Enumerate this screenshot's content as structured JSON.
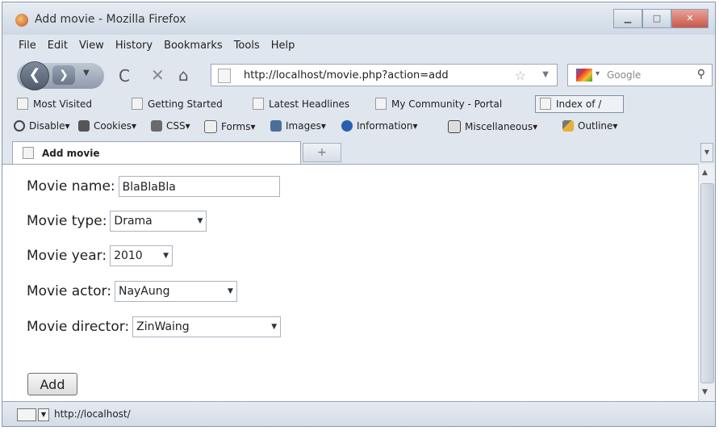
{
  "window": {
    "title": "Add movie - Mozilla Firefox",
    "minimize": "▁",
    "maximize": "□",
    "close": "✕"
  },
  "menu": [
    "File",
    "Edit",
    "View",
    "History",
    "Bookmarks",
    "Tools",
    "Help"
  ],
  "nav": {
    "url": "http://localhost/movie.php?action=add",
    "search_placeholder": "Google",
    "back": "❮",
    "forward": "❯"
  },
  "bookmarks": [
    "Most Visited",
    "Getting Started",
    "Latest Headlines",
    "My Community - Portal",
    "Index of /"
  ],
  "devbar": [
    "Disable",
    "Cookies",
    "CSS",
    "Forms",
    "Images",
    "Information",
    "Miscellaneous",
    "Outline"
  ],
  "tab": {
    "title": "Add movie",
    "new_tab": "+"
  },
  "form": {
    "name_label": "Movie name:",
    "name_value": "BlaBlaBla",
    "type_label": "Movie type:",
    "type_value": "Drama",
    "year_label": "Movie year:",
    "year_value": "2010",
    "actor_label": "Movie actor:",
    "actor_value": "NayAung",
    "director_label": "Movie director:",
    "director_value": "ZinWaing",
    "submit": "Add"
  },
  "status": {
    "text": "http://localhost/"
  }
}
